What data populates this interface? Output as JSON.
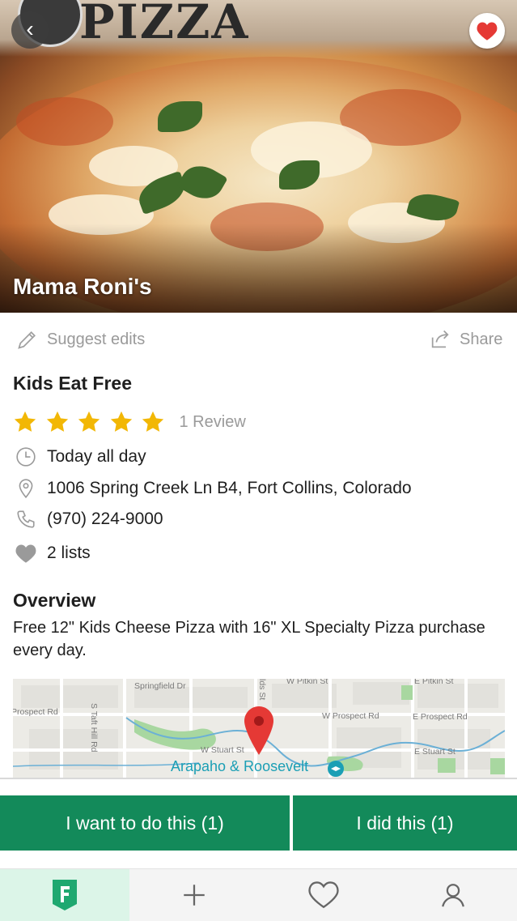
{
  "hero": {
    "logo_text": "PIZZA",
    "restaurant_name": "Mama Roni's"
  },
  "actions": {
    "suggest_edits": "Suggest edits",
    "share": "Share"
  },
  "deal": {
    "title": "Kids Eat Free",
    "rating": 5,
    "rating_max": 5,
    "review_count": "1 Review"
  },
  "details": {
    "hours": "Today all day",
    "address": "1006 Spring Creek Ln B4, Fort Collins, Colorado",
    "phone": "(970) 224-9000",
    "lists": "2 lists"
  },
  "overview": {
    "heading": "Overview",
    "text": "Free 12\" Kids Cheese Pizza with 16\" XL Specialty Pizza purchase every day."
  },
  "map": {
    "labels": [
      "Springfield Dr",
      "W Pitkin St",
      "E Pitkin St",
      "Prospect Rd",
      "W Prospect Rd",
      "E Prospect Rd",
      "W Stuart St",
      "E Stuart St",
      "S Taft Hill Rd",
      "lds St"
    ],
    "poi": "Arapaho & Roosevelt"
  },
  "buttons": {
    "want": "I want to do this (1)",
    "did": "I did this (1)"
  },
  "tabs": [
    "home-tab",
    "add-tab",
    "favorites-tab",
    "profile-tab"
  ],
  "colors": {
    "accent_green": "#138a5a",
    "star_yellow": "#f2b705",
    "heart_red": "#e53935",
    "active_tab_bg": "#dcf5e8",
    "poi_teal": "#1b9fb5"
  }
}
